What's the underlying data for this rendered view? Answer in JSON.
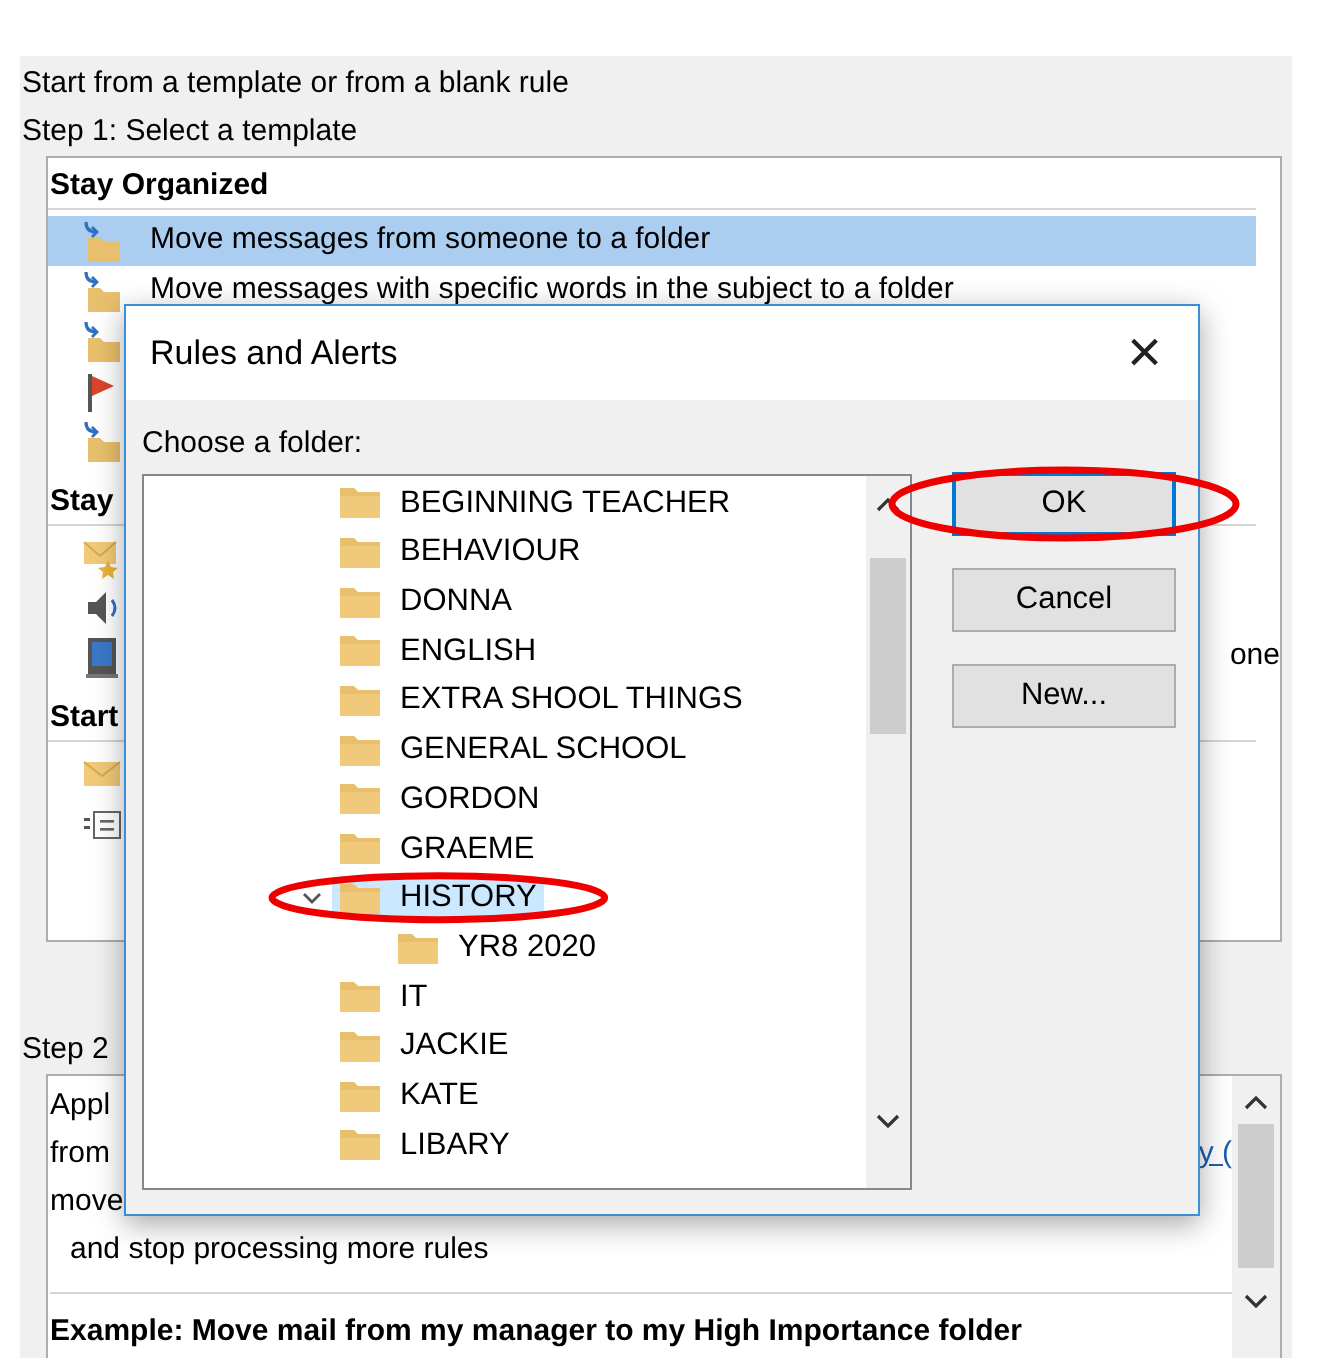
{
  "intro": "Start from a template or from a blank rule",
  "step1": "Step 1: Select a template",
  "template_groups": [
    {
      "title": "Stay Organized",
      "items": [
        {
          "kind": "move",
          "label": "Move messages from someone to a folder",
          "selected": true
        },
        {
          "kind": "move",
          "label": "Move messages with specific words in the subject to a folder",
          "selected": false
        },
        {
          "kind": "move",
          "selected": false
        },
        {
          "kind": "flag",
          "selected": false
        },
        {
          "kind": "move",
          "selected": false
        }
      ]
    },
    {
      "title": "Stay",
      "items": [
        {
          "kind": "alert",
          "selected": false
        },
        {
          "kind": "sound",
          "selected": false
        },
        {
          "kind": "display",
          "tail": "one",
          "selected": false
        }
      ]
    },
    {
      "title": "Start",
      "items": [
        {
          "kind": "mail",
          "selected": false
        },
        {
          "kind": "blank",
          "selected": false
        }
      ]
    }
  ],
  "step2": "Step 2",
  "description_lines": [
    {
      "text": "Appl",
      "indent": false
    },
    {
      "text": "from",
      "link": "y (",
      "indent": false
    },
    {
      "text": "move",
      "indent": false
    },
    {
      "text": "and stop processing more rules",
      "indent": true
    }
  ],
  "example": "Example: Move mail from my manager to my High Importance folder",
  "dialog": {
    "title": "Rules and Alerts",
    "close": "×",
    "prompt": "Choose a folder:",
    "folders": [
      {
        "label": "BEGINNING TEACHER",
        "selected": false
      },
      {
        "label": "BEHAVIOUR",
        "selected": false
      },
      {
        "label": "DONNA",
        "selected": false
      },
      {
        "label": "ENGLISH",
        "selected": false
      },
      {
        "label": "EXTRA SHOOL THINGS",
        "selected": false
      },
      {
        "label": "GENERAL SCHOOL",
        "selected": false
      },
      {
        "label": "GORDON",
        "selected": false
      },
      {
        "label": "GRAEME",
        "selected": false
      },
      {
        "label": "HISTORY",
        "selected": true,
        "highlighted": true,
        "expanded": true,
        "children": [
          {
            "label": "YR8 2020",
            "selected": false
          }
        ]
      },
      {
        "label": "IT",
        "selected": false
      },
      {
        "label": "JACKIE",
        "selected": false
      },
      {
        "label": "KATE",
        "selected": false
      },
      {
        "label": "LIBARY",
        "selected": false
      }
    ],
    "buttons": [
      {
        "label": "OK",
        "default": true,
        "highlighted": true
      },
      {
        "label": "Cancel",
        "default": false
      },
      {
        "label": "New...",
        "default": false
      }
    ]
  }
}
